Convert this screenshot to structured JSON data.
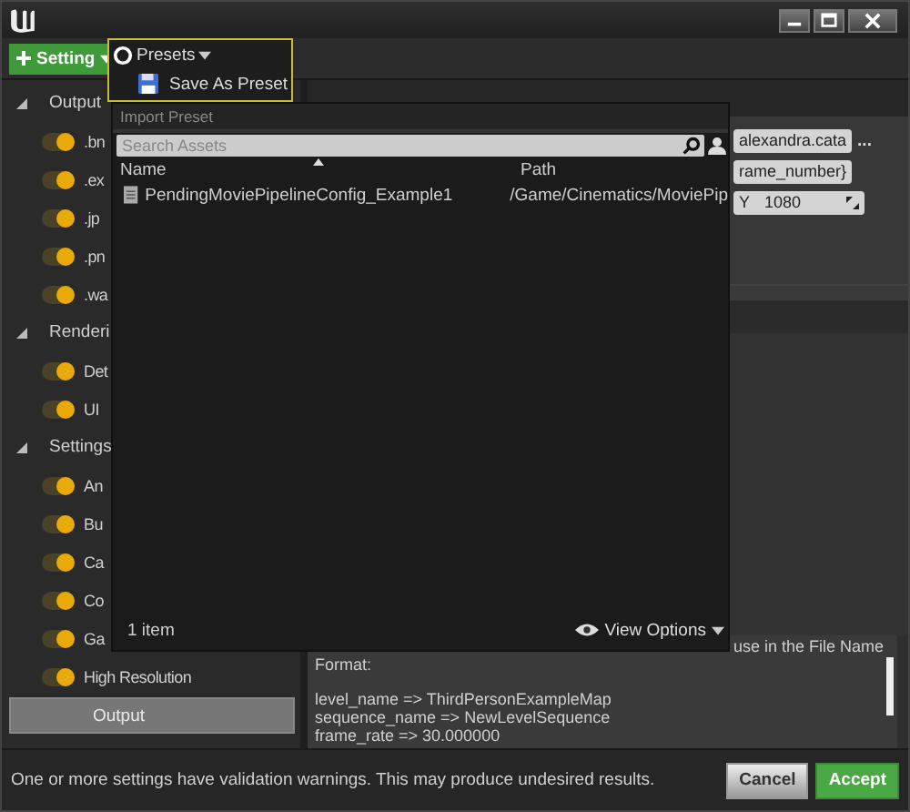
{
  "toolbar": {
    "add_button": "Setting"
  },
  "presets_menu": {
    "title": "Presets",
    "save_item": "Save As Preset",
    "import_heading": "Import Preset",
    "search": {
      "placeholder": "Search Assets"
    },
    "columns": [
      "Name",
      "Path"
    ],
    "assets": [
      {
        "name": "PendingMoviePipelineConfig_Example1",
        "path": "/Game/Cinematics/MoviePip"
      }
    ],
    "item_count": "1 item",
    "view_options": "View Options"
  },
  "sidebar": {
    "sections": [
      {
        "label": "Output",
        "expanded": true,
        "items": [
          {
            "label": ".bn",
            "enabled": true,
            "selected": false
          },
          {
            "label": ".ex",
            "enabled": true,
            "selected": false
          },
          {
            "label": ".jp",
            "enabled": true,
            "selected": false
          },
          {
            "label": ".pn",
            "enabled": true,
            "selected": false
          },
          {
            "label": ".wa",
            "enabled": true,
            "selected": false
          }
        ]
      },
      {
        "label": "Renderi",
        "expanded": true,
        "items": [
          {
            "label": "Det",
            "enabled": true,
            "selected": false
          },
          {
            "label": "UI",
            "enabled": true,
            "selected": false
          }
        ]
      },
      {
        "label": "Settings",
        "expanded": true,
        "items": [
          {
            "label": "An",
            "enabled": true,
            "selected": false
          },
          {
            "label": "Bu",
            "enabled": true,
            "selected": false
          },
          {
            "label": "Ca",
            "enabled": true,
            "selected": false
          },
          {
            "label": "Co",
            "enabled": true,
            "selected": false
          },
          {
            "label": "Ga",
            "enabled": true,
            "selected": false
          },
          {
            "label": "High Resolution",
            "enabled": true,
            "selected": false
          },
          {
            "label": "Output",
            "selected": true
          }
        ]
      }
    ]
  },
  "details": {
    "fields": [
      {
        "value": "alexandra.cata",
        "browse": "..."
      },
      {
        "value": "rame_number}"
      },
      {
        "label": "Y",
        "value": "1080"
      }
    ],
    "description": {
      "hint": "use in the File Name",
      "format_label": "Format:",
      "entries": [
        "level_name => ThirdPersonExampleMap",
        "sequence_name => NewLevelSequence",
        "frame_rate => 30.000000"
      ]
    }
  },
  "status_bar": {
    "message": "One or more settings have validation warnings. This may produce undesired results.",
    "buttons": [
      {
        "label": "Cancel",
        "kind": "secondary"
      },
      {
        "label": "Accept",
        "kind": "primary"
      }
    ]
  }
}
